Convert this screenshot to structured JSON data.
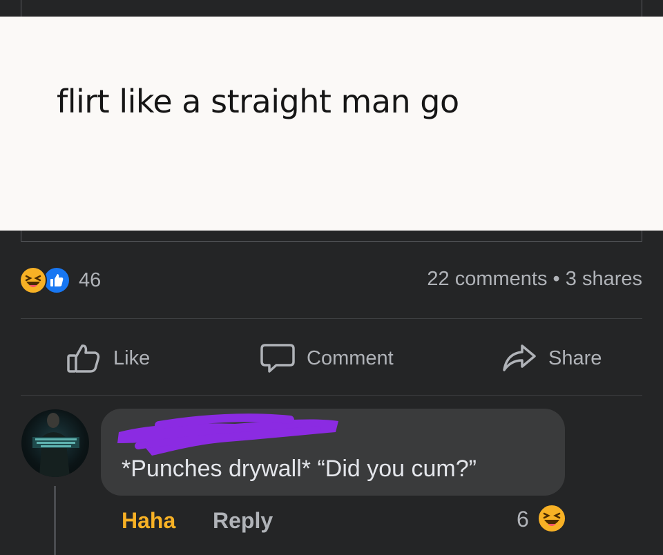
{
  "post": {
    "image_text": "flirt like a straight man go"
  },
  "reactions": {
    "count": "46",
    "types": [
      "haha",
      "like"
    ],
    "haha_color": "#f7b125",
    "like_color": "#1877f2"
  },
  "stats": {
    "text": "22 comments • 3 shares"
  },
  "actions": {
    "like_label": "Like",
    "comment_label": "Comment",
    "share_label": "Share",
    "like_icon": "thumbs-up-icon",
    "comment_icon": "speech-bubble-icon",
    "share_icon": "share-arrow-icon"
  },
  "comment": {
    "author_redacted": true,
    "redaction_color": "#8b2be2",
    "text": "*Punches drywall*  “Did you cum?”",
    "haha_label": "Haha",
    "haha_label_color": "#f7b125",
    "reply_label": "Reply",
    "reaction_count": "6",
    "reaction_type": "haha"
  },
  "colors": {
    "background": "#242526",
    "bubble": "#3a3b3c",
    "text_primary": "#e4e6eb",
    "text_secondary": "#b0b3b8"
  }
}
